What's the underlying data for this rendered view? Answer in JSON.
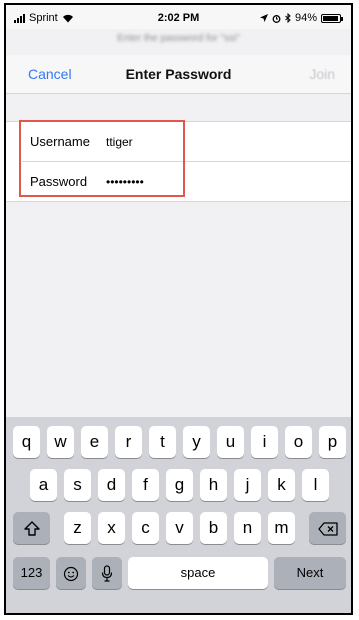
{
  "status_bar": {
    "carrier": "Sprint",
    "time": "2:02 PM",
    "battery": "94%"
  },
  "prompt": "Enter the password for \"ssi\"",
  "nav": {
    "cancel_label": "Cancel",
    "title": "Enter Password",
    "join_label": "Join"
  },
  "form": {
    "username_label": "Username",
    "username_value": "ttiger",
    "password_label": "Password",
    "password_value": "•••••••••"
  },
  "keyboard": {
    "row1": [
      "q",
      "w",
      "e",
      "r",
      "t",
      "y",
      "u",
      "i",
      "o",
      "p"
    ],
    "row2": [
      "a",
      "s",
      "d",
      "f",
      "g",
      "h",
      "j",
      "k",
      "l"
    ],
    "row3": [
      "z",
      "x",
      "c",
      "v",
      "b",
      "n",
      "m"
    ],
    "numbers_label": "123",
    "space_label": "space",
    "next_label": "Next"
  },
  "icons": {
    "emoji": "emoji-icon",
    "mic": "microphone-icon",
    "shift": "shift-icon",
    "delete": "delete-icon",
    "wifi": "wifi-icon",
    "signal": "signal-icon",
    "battery": "battery-icon",
    "location": "location-icon",
    "bluetooth": "bluetooth-icon",
    "alarm": "alarm-icon"
  },
  "colors": {
    "accent": "#3478f6",
    "highlight": "#e2574c",
    "disabled": "#c7c7cc",
    "keyboard_bg": "#d1d3d9"
  }
}
